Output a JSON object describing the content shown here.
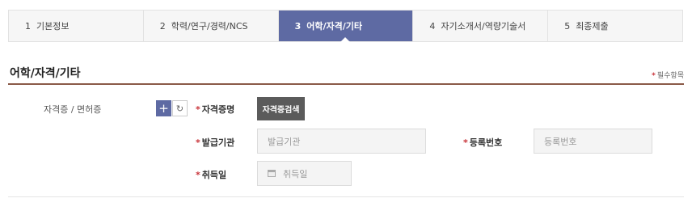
{
  "steps": [
    {
      "num": "1",
      "label": "기본정보"
    },
    {
      "num": "2",
      "label": "학력/연구/경력/NCS"
    },
    {
      "num": "3",
      "label": "어학/자격/기타"
    },
    {
      "num": "4",
      "label": "자기소개서/역량기술서"
    },
    {
      "num": "5",
      "label": "최종제출"
    }
  ],
  "active_step": 3,
  "section": {
    "title": "어학/자격/기타",
    "required_star": "*",
    "required_note": "필수항목"
  },
  "cert": {
    "row_label": "자격증 / 면허증",
    "add_icon": "plus-icon",
    "reset_icon": "refresh-icon",
    "add_symbol": "+",
    "reset_symbol": "↻",
    "name_label": "자격증명",
    "search_button": "자격증검색",
    "issuer_label": "발급기관",
    "issuer_placeholder": "발급기관",
    "reg_label": "등록번호",
    "reg_placeholder": "등록번호",
    "date_label": "취득일",
    "date_placeholder": "취득일",
    "date_icon": "calendar-icon"
  },
  "colors": {
    "active_step": "#5e6aa3",
    "required": "#c8333a",
    "section_line": "#8a5a48",
    "search_button": "#5b5b5b"
  }
}
